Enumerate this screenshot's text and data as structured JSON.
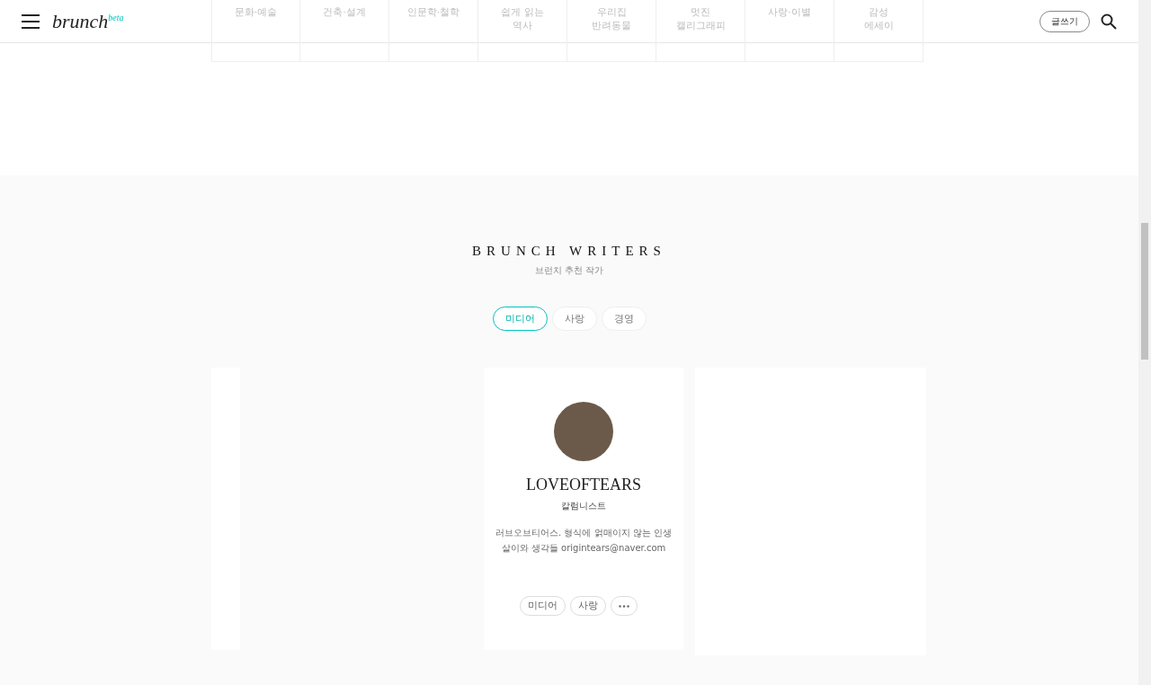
{
  "header": {
    "logo": "brunch",
    "logo_badge": "beta",
    "write_button": "글쓰기"
  },
  "categories": [
    "문화·예술",
    "건축·설계",
    "인문학·철학",
    "쉽게 읽는\n역사",
    "우리집\n반려동물",
    "멋진\n캘리그래피",
    "사랑·이별",
    "감성\n에세이"
  ],
  "writers": {
    "title": "BRUNCH WRITERS",
    "subtitle": "브런치 추천 작가",
    "tabs": [
      {
        "label": "미디어",
        "selected": true
      },
      {
        "label": "사랑",
        "selected": false
      },
      {
        "label": "경영",
        "selected": false
      }
    ],
    "card": {
      "name": "LOVEOFTEARS",
      "role": "칼럼니스트",
      "bio": "러브오브티어스. 형식에 얽매이지 않는 인생살이와 생각들 origintears@naver.com",
      "tags": [
        "미디어",
        "사랑"
      ]
    }
  }
}
